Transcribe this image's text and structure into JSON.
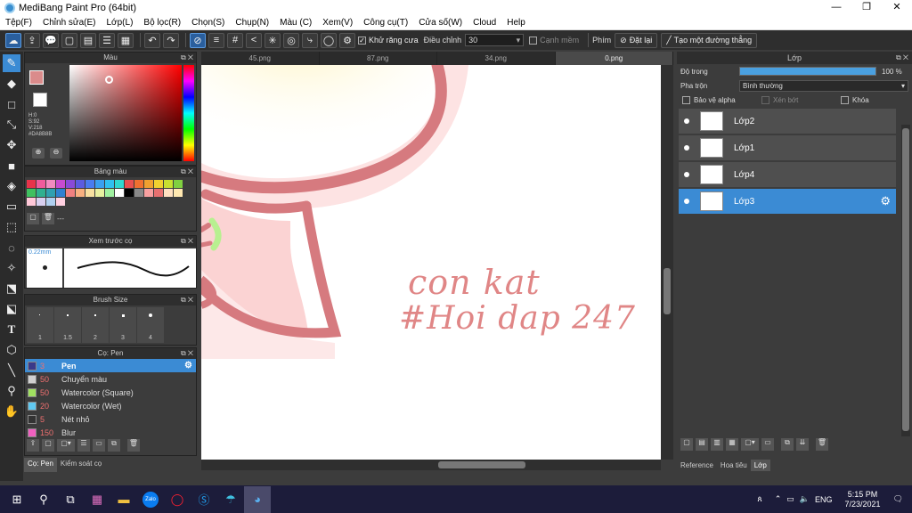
{
  "title": "MediBang Paint Pro (64bit)",
  "menu": [
    "Tệp(F)",
    "Chỉnh sửa(E)",
    "Lớp(L)",
    "Bộ lọc(R)",
    "Chọn(S)",
    "Chụp(N)",
    "Màu (C)",
    "Xem(V)",
    "Công cụ(T)",
    "Cửa số(W)",
    "Cloud",
    "Help"
  ],
  "toolbar": {
    "antialias_label": "Khử răng cưa",
    "adjust_label": "Điều chỉnh",
    "adjust_value": "30",
    "edge_label": "Cạnh mềm",
    "key_label": "Phím",
    "reset_label": "Đặt lại",
    "line_label": "Tạo một đường thẳng"
  },
  "color_panel": {
    "title": "Màu",
    "h": "H:0",
    "s": "S:92",
    "v": "V:218",
    "hex": "#DA8B8B",
    "fg": "#da8b8b"
  },
  "palette_panel": {
    "title": "Bảng màu",
    "bar_text": "---",
    "swatches": [
      "#e8334a",
      "#f05b9c",
      "#f28bc0",
      "#c84bd0",
      "#8a4ad8",
      "#5c5ce0",
      "#4a7cf0",
      "#3aa0f0",
      "#30c0f0",
      "#30d8d0",
      "#e85050",
      "#f07030",
      "#f0a030",
      "#f0d030",
      "#c8e030",
      "#80d040",
      "#40c060",
      "#30b090",
      "#30a0b0",
      "#3080d0",
      "#f08080",
      "#f8b080",
      "#f8e0a0",
      "#e8f0a0",
      "#a0f0a0",
      "#ffffff",
      "#000000",
      "#888888",
      "#f8a0a0",
      "#e87070",
      "#ffe0c0",
      "#ffe8b0",
      "#ffc8d8",
      "#d8d0f0",
      "#b0d0f0",
      "#ffd0e0"
    ]
  },
  "preview_panel": {
    "title": "Xem trước cọ",
    "size": "0.22mm"
  },
  "brushsize_panel": {
    "title": "Brush Size",
    "sizes": [
      "1",
      "1.5",
      "2",
      "3",
      "4"
    ]
  },
  "brush_panel": {
    "title": "Cọ: Pen",
    "items": [
      {
        "size": "3",
        "name": "Pen",
        "color": "#3a3a8a"
      },
      {
        "size": "50",
        "name": "Chuyển màu",
        "color": "#d0d0d0"
      },
      {
        "size": "50",
        "name": "Watercolor (Square)",
        "color": "#a0e060"
      },
      {
        "size": "20",
        "name": "Watercolor (Wet)",
        "color": "#60c8f0"
      },
      {
        "size": "5",
        "name": "Nét nhỏ",
        "color": "#333333"
      },
      {
        "size": "150",
        "name": "Blur",
        "color": "#f060c0"
      }
    ]
  },
  "bottom_tabs": [
    "Cọ: Pen",
    "Kiểm soát cọ"
  ],
  "canvas_tabs": [
    "45.png",
    "87.png",
    "34.png",
    "0.png"
  ],
  "layer_panel": {
    "title": "Lớp",
    "opacity_label": "Độ trong",
    "opacity_value": "100 %",
    "opacity": 1.0,
    "blend_label": "Pha trộn",
    "blend_value": "Bình thường",
    "alpha_label": "Bảo vệ alpha",
    "clip_label": "Xén bớt",
    "lock_label": "Khóa",
    "layers": [
      "Lớp2",
      "Lớp1",
      "Lớp4",
      "Lớp3"
    ],
    "tabs": [
      "Reference",
      "Hoa tiêu",
      "Lớp"
    ]
  },
  "canvas_text": {
    "line1": "con kat",
    "line2": "#Hoi dap 247"
  },
  "taskbar": {
    "time": "5:15 PM",
    "date": "7/23/2021",
    "lang": "ENG",
    "zalo": "Zalo"
  }
}
